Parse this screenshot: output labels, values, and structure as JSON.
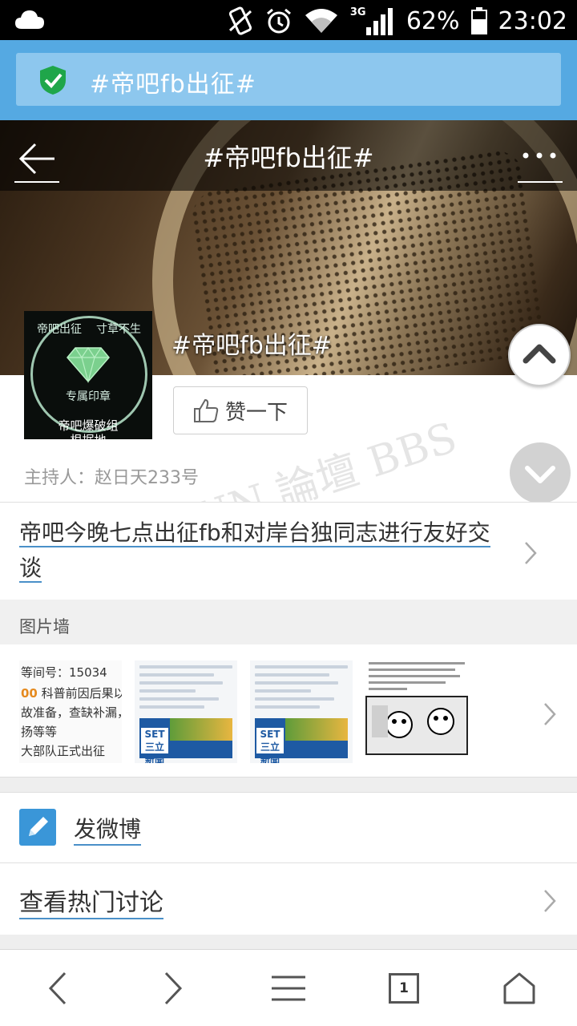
{
  "status_bar": {
    "network": "3G",
    "battery": "62%",
    "time": "23:02",
    "icons": [
      "cloud-icon",
      "vibrate-icon",
      "alarm-icon",
      "wifi-icon",
      "signal-icon",
      "battery-icon"
    ]
  },
  "url_bar": {
    "text": "#帝吧fb出征#",
    "icon": "shield-check-icon"
  },
  "header": {
    "title": "#帝吧fb出征#",
    "topic_name": "#帝吧fb出征#"
  },
  "avatar": {
    "seal_left": "帝吧出征",
    "seal_right": "寸草不生",
    "seal_center": "专属印章",
    "caption_1": "帝吧爆破组",
    "caption_2": "根据地"
  },
  "like_button": {
    "label": "赞一下",
    "icon": "thumb-up-icon"
  },
  "host": {
    "label": "主持人：赵日天233号"
  },
  "watermark": "KUN 論壇 BBS",
  "topic": {
    "text": "帝吧今晚七点出征fb和对岸台独同志进行友好交谈"
  },
  "picture_wall": {
    "label": "图片墙",
    "thumb1_lines": [
      {
        "prefix": "",
        "text": "等间号：15034"
      },
      {
        "prefix": "00",
        "text": " 科普前因后果以及解"
      },
      {
        "prefix": "",
        "text": "故准备，查缺补漏，账号"
      },
      {
        "prefix": "",
        "text": "扬等等"
      },
      {
        "prefix": "",
        "text": "大部队正式出征"
      }
    ],
    "thumb2_logo": "SET 三立新聞",
    "thumb3_logo": "SET 三立新聞"
  },
  "weibo": {
    "label": "发微博",
    "icon": "pencil-icon"
  },
  "hot": {
    "label": "查看热门讨论"
  },
  "bottom_nav": {
    "tabs_count": "1"
  },
  "colors": {
    "accent": "#55a9e2",
    "link_underline": "#4a90c8"
  }
}
